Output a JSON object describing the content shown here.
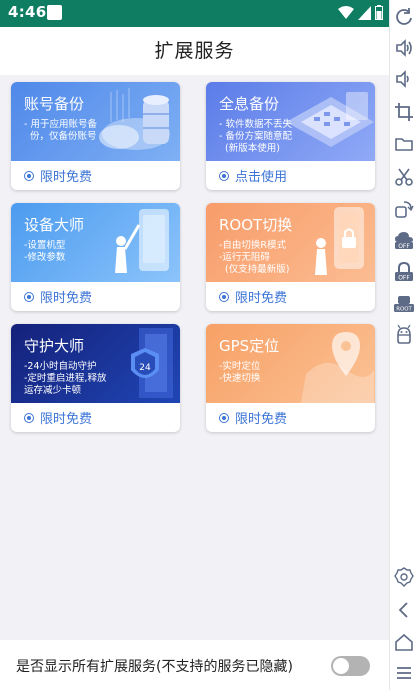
{
  "status_bar": {
    "time": "4:46"
  },
  "header": {
    "title": "扩展服务"
  },
  "cards": [
    {
      "title": "账号备份",
      "desc": "- 用于应用账号备\n  份，仅备份账号",
      "footer": "限时免费"
    },
    {
      "title": "全息备份",
      "desc": "- 软件数据不丢失\n- 备份方案随意配\n  (新版本使用)",
      "footer": "点击使用"
    },
    {
      "title": "设备大师",
      "desc": "-设置机型\n-修改参数",
      "footer": "限时免费"
    },
    {
      "title": "ROOT切换",
      "desc": "-自由切换R模式\n-运行无阻碍\n  (仅支持最新版)",
      "footer": "限时免费"
    },
    {
      "title": "守护大师",
      "desc": "-24小时自动守护\n-定时重启进程,释放\n运存减少卡顿",
      "footer": "限时免费"
    },
    {
      "title": "GPS定位",
      "desc": "-实时定位\n-快速切换",
      "footer": "限时免费"
    }
  ],
  "bottom": {
    "label": "是否显示所有扩展服务(不支持的服务已隐藏)",
    "toggle_on": false
  },
  "side_toolbar": {
    "badge_off_1": "OFF",
    "badge_off_2": "OFF",
    "badge_root": "ROOT",
    "icons": [
      "refresh-icon",
      "volume-up-icon",
      "volume-down-icon",
      "crop-icon",
      "folder-icon",
      "scissors-icon",
      "rotate-icon",
      "cloud-off-icon",
      "lock-off-icon",
      "root-icon",
      "android-icon",
      "settings-icon",
      "back-icon",
      "home-icon",
      "menu-icon"
    ]
  },
  "colors": {
    "accent": "#3b74d6",
    "status_bar": "#0f7d62"
  }
}
